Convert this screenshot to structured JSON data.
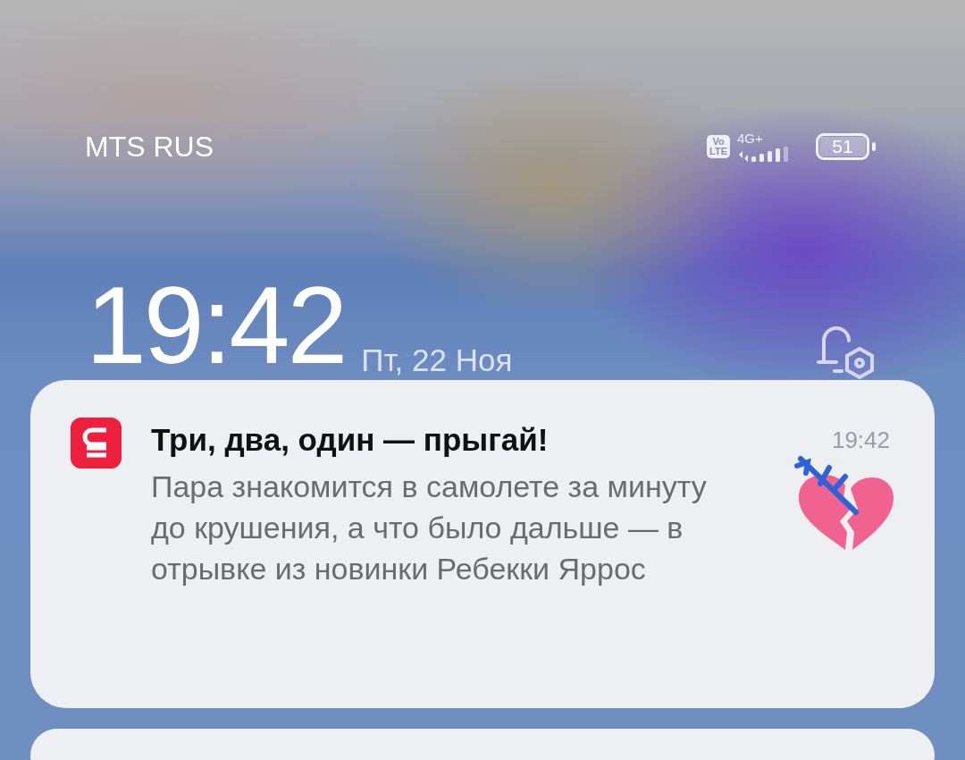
{
  "status_bar": {
    "carrier": "MTS RUS",
    "volte_top": "Vo",
    "volte_bottom": "LTE",
    "network": "4G+",
    "battery": "51"
  },
  "lock_clock": {
    "time": "19:42",
    "date": "Пт, 22 Ноя"
  },
  "notifications": [
    {
      "title": "Три, два, один — прыгай!",
      "time": "19:42",
      "body": "Пара знакомится в самолете за минуту до крушения, а что было дальше — в отрывке из новинки Ребекки Яррос"
    }
  ]
}
